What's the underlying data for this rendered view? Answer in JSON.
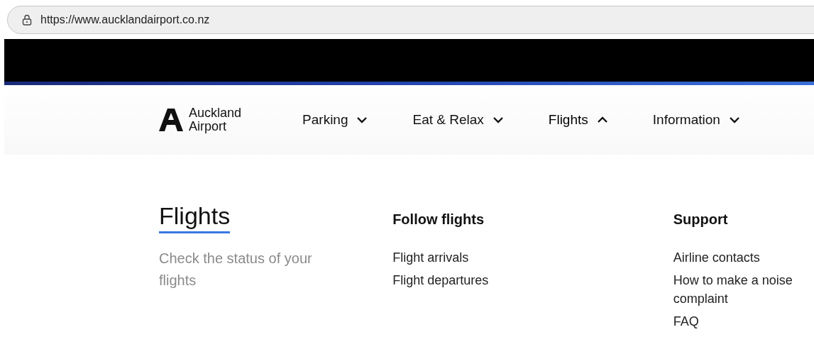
{
  "address_bar": {
    "url": "https://www.aucklandairport.co.nz"
  },
  "logo": {
    "line_1": "Auckland",
    "line_2": "Airport"
  },
  "nav": [
    {
      "label": "Parking",
      "expanded": false
    },
    {
      "label": "Eat & Relax",
      "expanded": false
    },
    {
      "label": "Flights",
      "expanded": true
    },
    {
      "label": "Information",
      "expanded": false
    }
  ],
  "menu": {
    "title": "Flights",
    "description": "Check the status of your flights",
    "columns": [
      {
        "heading": "Follow flights",
        "links": [
          "Flight arrivals",
          "Flight departures"
        ]
      },
      {
        "heading": "Support",
        "links": [
          "Airline contacts",
          "How to make a noise complaint",
          "FAQ"
        ]
      }
    ]
  }
}
